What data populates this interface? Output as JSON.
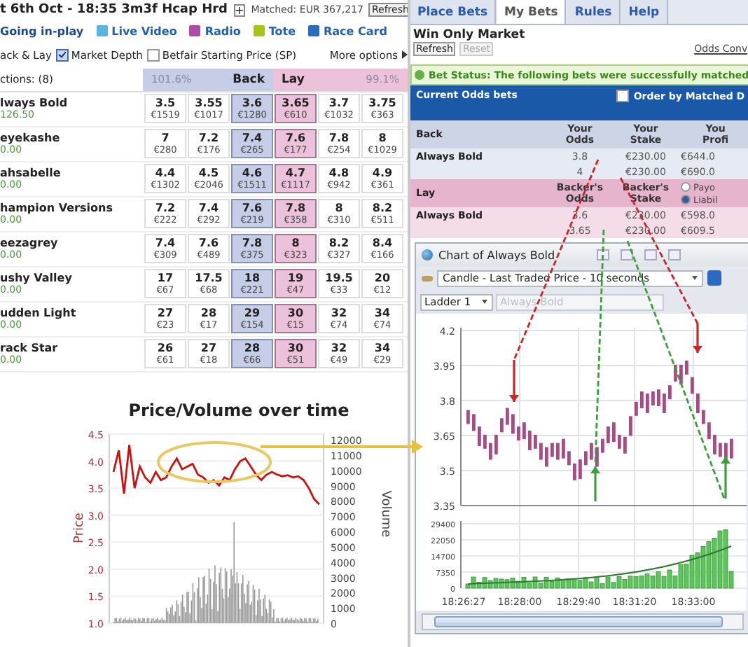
{
  "market": {
    "title": "t 6th Oct - 18:35 3m3f Hcap Hrd",
    "expand": "+",
    "matched": "Matched: EUR 367,217",
    "refresh": "Refresh"
  },
  "links": [
    {
      "label": "Going in-play"
    },
    {
      "label": "Live Video",
      "color": "#5ab4e0"
    },
    {
      "label": "Radio",
      "color": "#b04ca8"
    },
    {
      "label": "Tote",
      "color": "#a8c418"
    },
    {
      "label": "Race Card",
      "color": "#2a6cc0"
    }
  ],
  "options": {
    "back_lay": "ack & Lay",
    "checks": [
      {
        "label": "Market Depth",
        "checked": true
      },
      {
        "label": "Betfair Starting Price (SP)",
        "checked": false
      }
    ],
    "more": "More options"
  },
  "ladder_head": {
    "selections": "ctions: (8)",
    "back_percent": "101.6%",
    "back": "Back",
    "lay": "Lay",
    "lay_percent": "99.1%"
  },
  "runners": [
    {
      "name": "lways Bold",
      "pl": "126.50",
      "prices": [
        [
          "3.5",
          "€1519"
        ],
        [
          "3.55",
          "€1017"
        ],
        [
          "3.6",
          "€1280"
        ],
        [
          "3.65",
          "€610"
        ],
        [
          "3.7",
          "€1032"
        ],
        [
          "3.75",
          "€363"
        ]
      ]
    },
    {
      "name": "eyekashe",
      "pl": "0.00",
      "prices": [
        [
          "7",
          "€280"
        ],
        [
          "7.2",
          "€176"
        ],
        [
          "7.4",
          "€265"
        ],
        [
          "7.6",
          "€177"
        ],
        [
          "7.8",
          "€254"
        ],
        [
          "8",
          "€1029"
        ]
      ]
    },
    {
      "name": "ahsabelle",
      "pl": "0.00",
      "prices": [
        [
          "4.4",
          "€1302"
        ],
        [
          "4.5",
          "€2046"
        ],
        [
          "4.6",
          "€1511"
        ],
        [
          "4.7",
          "€1117"
        ],
        [
          "4.8",
          "€942"
        ],
        [
          "4.9",
          "€361"
        ]
      ]
    },
    {
      "name": "hampion Versions",
      "pl": "0.00",
      "prices": [
        [
          "7.2",
          "€222"
        ],
        [
          "7.4",
          "€292"
        ],
        [
          "7.6",
          "€219"
        ],
        [
          "7.8",
          "€358"
        ],
        [
          "8",
          "€310"
        ],
        [
          "8.2",
          "€511"
        ]
      ]
    },
    {
      "name": "eezagrey",
      "pl": "0.00",
      "prices": [
        [
          "7.4",
          "€309"
        ],
        [
          "7.6",
          "€489"
        ],
        [
          "7.8",
          "€375"
        ],
        [
          "8",
          "€323"
        ],
        [
          "8.2",
          "€327"
        ],
        [
          "8.4",
          "€166"
        ]
      ]
    },
    {
      "name": "ushy Valley",
      "pl": "0.00",
      "prices": [
        [
          "17",
          "€67"
        ],
        [
          "17.5",
          "€68"
        ],
        [
          "18",
          "€221"
        ],
        [
          "19",
          "€47"
        ],
        [
          "19.5",
          "€33"
        ],
        [
          "20",
          "€12"
        ]
      ]
    },
    {
      "name": "udden Light",
      "pl": "0.00",
      "prices": [
        [
          "27",
          "€23"
        ],
        [
          "28",
          "€17"
        ],
        [
          "29",
          "€154"
        ],
        [
          "30",
          "€15"
        ],
        [
          "32",
          "€74"
        ],
        [
          "34",
          "€74"
        ]
      ]
    },
    {
      "name": "rack Star",
      "pl": "0.00",
      "prices": [
        [
          "26",
          "€61"
        ],
        [
          "27",
          "€18"
        ],
        [
          "28",
          "€66"
        ],
        [
          "30",
          "€51"
        ],
        [
          "32",
          "€49"
        ],
        [
          "34",
          "€29"
        ]
      ]
    }
  ],
  "price_chart": {
    "chart_data": {
      "type": "line",
      "title": "Price/Volume over time",
      "ylabel": "Price",
      "ylim": [
        1,
        4.5
      ],
      "yticks": [
        {
          "value": 4.5,
          "label": "4.5"
        },
        {
          "value": 4,
          "label": "4.0"
        },
        {
          "value": 3.5,
          "label": "3.5"
        },
        {
          "value": 3,
          "label": "3.0"
        },
        {
          "value": 2.5,
          "label": "2.5"
        },
        {
          "value": 2,
          "label": "2.0"
        },
        {
          "value": 1.5,
          "label": "1.5"
        },
        {
          "value": 1,
          "label": "1.0"
        }
      ],
      "grid": true,
      "series": [
        {
          "color": "#cc1010",
          "values": [
            3.8,
            4.2,
            3.4,
            4.3,
            3.5,
            3.9,
            3.7,
            3.6,
            3.8,
            3.65,
            3.7,
            3.9,
            4.05,
            3.85,
            3.9,
            3.95,
            3.75,
            3.7,
            3.6,
            3.65,
            3.55,
            3.7,
            3.65,
            3.85,
            4.0,
            4.05,
            3.9,
            3.75,
            3.65,
            3.75,
            3.8,
            3.75,
            3.72,
            3.74,
            3.7,
            3.72,
            3.65,
            3.5,
            3.3,
            3.2
          ]
        }
      ]
    },
    "y2label": "Volume",
    "volume_ticks": [
      "12000",
      "11000",
      "10000",
      "9000",
      "8000",
      "7000",
      "6000",
      "5000",
      "4000",
      "3000",
      "2000",
      "1000",
      "0"
    ]
  },
  "tabs": [
    {
      "label": "Place Bets",
      "selected": false
    },
    {
      "label": "My Bets",
      "selected": true
    },
    {
      "label": "Rules",
      "selected": false
    },
    {
      "label": "Help",
      "selected": false
    }
  ],
  "bets_panel": {
    "market": "Win Only Market",
    "buttons": [
      {
        "label": "Refresh",
        "disabled": false
      },
      {
        "label": "Reset",
        "disabled": true
      }
    ],
    "odds_link": "Odds Conv",
    "status": "Bet Status: The following bets were successfully matched",
    "current": "Current Odds bets",
    "order": {
      "label": "Order by Matched D",
      "checked": false
    }
  },
  "sections": [
    {
      "kind": "back",
      "label": "Back",
      "headers": [
        [
          "Your",
          "Odds"
        ],
        [
          "Your",
          "Stake"
        ],
        [
          "You",
          "Profi"
        ]
      ],
      "bets": [
        {
          "runner": "Always Bold",
          "odds": "3.8",
          "stake": "€230.00",
          "profit": "€644.0"
        },
        {
          "odds": "4",
          "stake": "€230.00",
          "profit": "€690.0"
        }
      ]
    },
    {
      "kind": "lay",
      "label": "Lay",
      "headers": [
        [
          "Backer's",
          "Odds"
        ],
        [
          "Backer's",
          "Stake"
        ]
      ],
      "radios": [
        {
          "label": "Payo",
          "selected": false
        },
        {
          "label": "Liabil",
          "selected": true
        }
      ],
      "bets": [
        {
          "runner": "Always Bold",
          "odds": "3.6",
          "stake": "€230.00",
          "profit": "€598.0"
        },
        {
          "odds": "3.65",
          "stake": "€230.00",
          "profit": "€609.5"
        }
      ]
    }
  ],
  "chart_window": {
    "title": "Chart of Always Bold",
    "chart_type": "Candle - Last Traded Price - 10 seconds",
    "ladder": "Ladder 1",
    "runner": "Always Bold",
    "price_ticks": [
      "4.2",
      "3.95",
      "3.8",
      "3.65",
      "3.5",
      "3.35"
    ],
    "volume_ticks": [
      "29400",
      "22050",
      "14700",
      "7350",
      "0"
    ],
    "time_ticks": [
      "18:26:27",
      "18:28:00",
      "18:29:40",
      "18:31:20",
      "18:33:00"
    ]
  }
}
